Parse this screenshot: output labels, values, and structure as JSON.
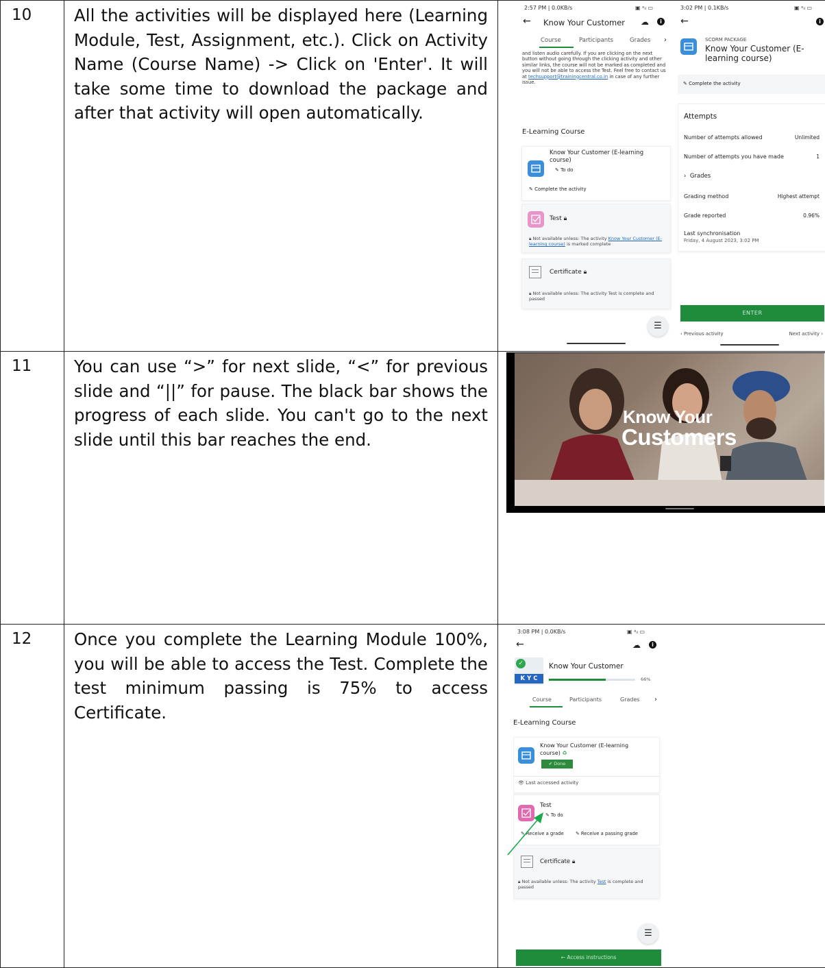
{
  "rows": [
    {
      "num": "10",
      "text": "All the activities will be displayed here (Learning Module, Test, Assignment, etc.). Click on Activity Name (Course Name) -> Click on 'Enter'. It will take some time to download the package and after that activity will open automatically.",
      "screen_a": {
        "status_left": "2:57 PM | 0.0KB/s",
        "status_right": "4G",
        "title": "Know Your Customer",
        "tabs": [
          "Course",
          "Participants",
          "Grades"
        ],
        "intro_text": "and listen audio carefully. If you are clicking on the next button without going through the clicking activity and other similar links, the course will not be marked as completed and you will not be able to access the Test. Feel free to contact us at",
        "intro_link": "techsupport@trainingcentral.co.in",
        "intro_tail": "in case of any further issue.",
        "section_title": "E-Learning Course",
        "activity1_name": "Know Your Customer (E-learning course)",
        "activity1_badge": "To do",
        "activity1_action": "Complete the activity",
        "activity2_name": "Test",
        "activity2_restriction": "Not available unless: The activity",
        "activity2_restriction_link": "Know Your Customer (E-learning course)",
        "activity2_restriction_tail": "is marked complete",
        "activity3_name": "Certificate",
        "activity3_restriction": "Not available unless: The activity Test is complete and passed"
      },
      "screen_b": {
        "status_left": "3:02 PM | 0.1KB/s",
        "package_label": "SCORM PACKAGE",
        "package_title": "Know Your Customer (E-learning course)",
        "complete_label": "Complete the activity",
        "attempts_title": "Attempts",
        "rows": [
          {
            "label": "Number of attempts allowed",
            "value": "Unlimited"
          },
          {
            "label": "Number of attempts you have made",
            "value": "1"
          }
        ],
        "grades_label": "Grades",
        "grading_method_label": "Grading method",
        "grading_method_value": "Highest attempt",
        "grade_reported_label": "Grade reported",
        "grade_reported_value": "0.96%",
        "last_sync_label": "Last synchronisation",
        "last_sync_value": "Friday, 4 August 2023, 3:02 PM",
        "enter_label": "ENTER",
        "prev_label": "Previous activity",
        "next_label": "Next activity"
      }
    },
    {
      "num": "11",
      "text": "You can use “>” for next slide, “<” for previous slide and “||” for pause. The black bar shows the progress of each slide. You can't go to the next slide until this bar reaches the end.",
      "slide": {
        "title_line1": "Know Your",
        "title_line2": "Customers"
      }
    },
    {
      "num": "12",
      "text": "Once you complete the Learning Module 100%, you will be able to access the Test. Complete the test minimum passing is 75% to access Certificate.",
      "screen_c": {
        "status_left": "3:08 PM | 0.0KB/s",
        "title": "Know Your Customer",
        "logo_text": "K Y C",
        "progress": 0.66,
        "progress_label": "66%",
        "tabs": [
          "Course",
          "Participants",
          "Grades"
        ],
        "section_title": "E-Learning Course",
        "activity1_name": "Know Your Customer (E-learning course)",
        "activity1_badge": "Done",
        "last_accessed": "Last accessed activity",
        "activity2_name": "Test",
        "activity2_badge": "To do",
        "activity2_cond1": "Receive a grade",
        "activity2_cond2": "Receive a passing grade",
        "activity3_name": "Certificate",
        "activity3_restriction": "Not available unless: The activity",
        "activity3_restriction_link": "Test",
        "activity3_restriction_tail": "is complete and passed",
        "access_button": "Access instructions"
      }
    }
  ],
  "colors": {
    "green": "#1e8c3a",
    "blue_icon": "#3a8fd8",
    "pink_icon": "#e06ab0",
    "arrow": "#1aa84a"
  }
}
